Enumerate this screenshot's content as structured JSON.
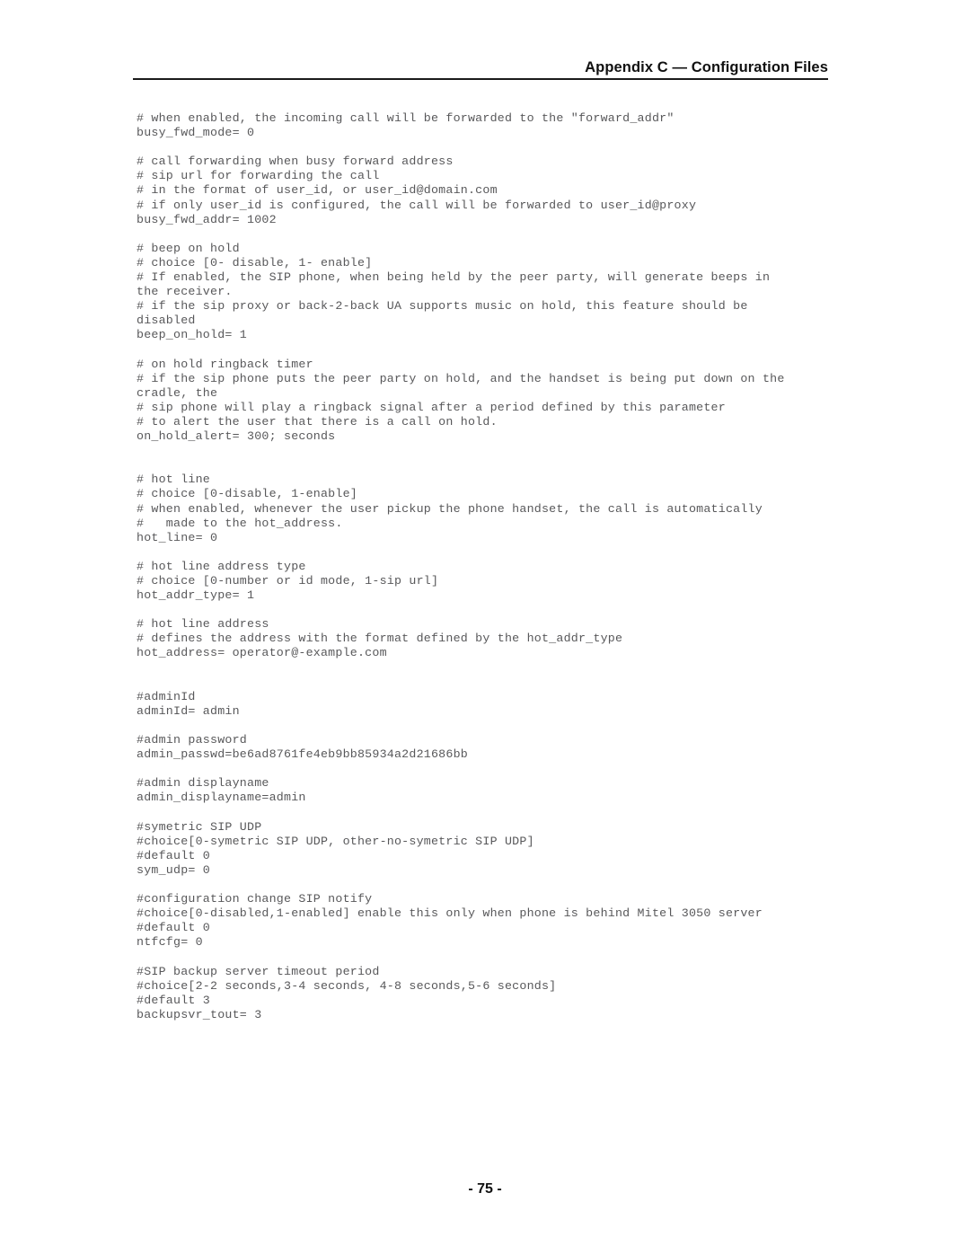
{
  "document": {
    "header": {
      "title": "Appendix C — Configuration Files"
    },
    "footer": {
      "page_number": "- 75 -"
    },
    "colors": {
      "page_background": "#ffffff",
      "header_text": "#111111",
      "header_rule": "#1a1a1a",
      "code_text": "#58585a"
    },
    "config_file": {
      "lines": [
        "# when enabled, the incoming call will be forwarded to the \"forward_addr\"",
        "busy_fwd_mode= 0",
        "",
        "# call forwarding when busy forward address",
        "# sip url for forwarding the call",
        "# in the format of user_id, or user_id@domain.com",
        "# if only user_id is configured, the call will be forwarded to user_id@proxy",
        "busy_fwd_addr= 1002",
        "",
        "# beep on hold",
        "# choice [0- disable, 1- enable]",
        "# If enabled, the SIP phone, when being held by the peer party, will generate beeps in",
        "the receiver.",
        "# if the sip proxy or back-2-back UA supports music on hold, this feature should be",
        "disabled",
        "beep_on_hold= 1",
        "",
        "# on hold ringback timer",
        "# if the sip phone puts the peer party on hold, and the handset is being put down on the",
        "cradle, the",
        "# sip phone will play a ringback signal after a period defined by this parameter",
        "# to alert the user that there is a call on hold.",
        "on_hold_alert= 300; seconds",
        "",
        "",
        "# hot line",
        "# choice [0-disable, 1-enable]",
        "# when enabled, whenever the user pickup the phone handset, the call is automatically",
        "#   made to the hot_address.",
        "hot_line= 0",
        "",
        "# hot line address type",
        "# choice [0-number or id mode, 1-sip url]",
        "hot_addr_type= 1",
        "",
        "# hot line address",
        "# defines the address with the format defined by the hot_addr_type",
        "hot_address= operator@-example.com",
        "",
        "",
        "#adminId",
        "adminId= admin",
        "",
        "#admin password",
        "admin_passwd=be6ad8761fe4eb9bb85934a2d21686bb",
        "",
        "#admin displayname",
        "admin_displayname=admin",
        "",
        "#symetric SIP UDP",
        "#choice[0-symetric SIP UDP, other-no-symetric SIP UDP]",
        "#default 0",
        "sym_udp= 0",
        "",
        "#configuration change SIP notify",
        "#choice[0-disabled,1-enabled] enable this only when phone is behind Mitel 3050 server",
        "#default 0",
        "ntfcfg= 0",
        "",
        "#SIP backup server timeout period",
        "#choice[2-2 seconds,3-4 seconds, 4-8 seconds,5-6 seconds]",
        "#default 3",
        "backupsvr_tout= 3"
      ]
    }
  }
}
